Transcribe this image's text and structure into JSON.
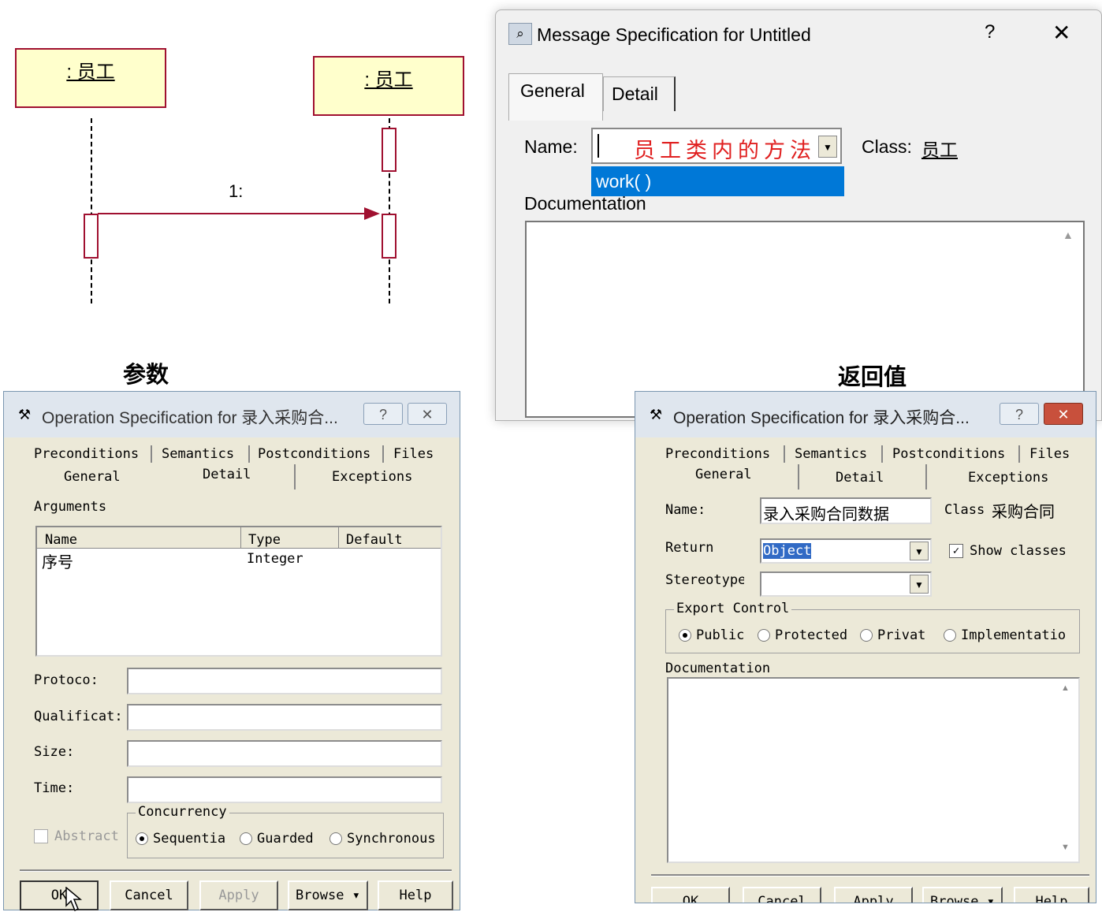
{
  "sequence": {
    "object1": ": 员工",
    "object2": ": 员工",
    "message_label": "1:"
  },
  "message_dialog": {
    "title": "Message Specification for Untitled",
    "help_button": "?",
    "close_button": "✕",
    "tabs": [
      "General",
      "Detail"
    ],
    "name_label": "Name:",
    "name_value": "",
    "name_overlay": "员工类内的方法",
    "dropdown_option": "work( )",
    "class_label": "Class:",
    "class_value": "员工",
    "documentation_label": "Documentation"
  },
  "captions": {
    "params": "参数",
    "return": "返回值"
  },
  "op_dialog_left": {
    "title": "Operation Specification for 录入采购合...",
    "tabs_row1": [
      "Preconditions",
      "Semantics",
      "Postconditions",
      "Files"
    ],
    "tabs_row2": [
      "General",
      "Detail",
      "Exceptions"
    ],
    "arguments_label": "Arguments",
    "columns": [
      "Name",
      "Type",
      "Default"
    ],
    "rows": [
      [
        "序号",
        "Integer",
        ""
      ]
    ],
    "protocol_label": "Protoco:",
    "qualification_label": "Qualificat:",
    "size_label": "Size:",
    "time_label": "Time:",
    "abstract_label": "Abstract",
    "concurrency_label": "Concurrency",
    "concurrency_options": [
      "Sequentia",
      "Guarded",
      "Synchronous"
    ],
    "buttons": [
      "OK",
      "Cancel",
      "Apply",
      "Browse ▾",
      "Help"
    ]
  },
  "op_dialog_right": {
    "title": "Operation Specification for 录入采购合...",
    "tabs_row1": [
      "Preconditions",
      "Semantics",
      "Postconditions",
      "Files"
    ],
    "tabs_row2": [
      "General",
      "Detail",
      "Exceptions"
    ],
    "name_label": "Name:",
    "name_value": "录入采购合同数据",
    "class_label": "Class",
    "class_value": "采购合同",
    "return_label": "Return",
    "return_value": "Object",
    "show_classes_label": "Show classes",
    "stereotype_label": "Stereotype",
    "export_control_label": "Export Control",
    "export_options": [
      "Public",
      "Protected",
      "Privat",
      "Implementatio"
    ],
    "documentation_label": "Documentation",
    "buttons": [
      "OK",
      "Cancel",
      "Apply",
      "Browse ▾",
      "Help"
    ]
  }
}
